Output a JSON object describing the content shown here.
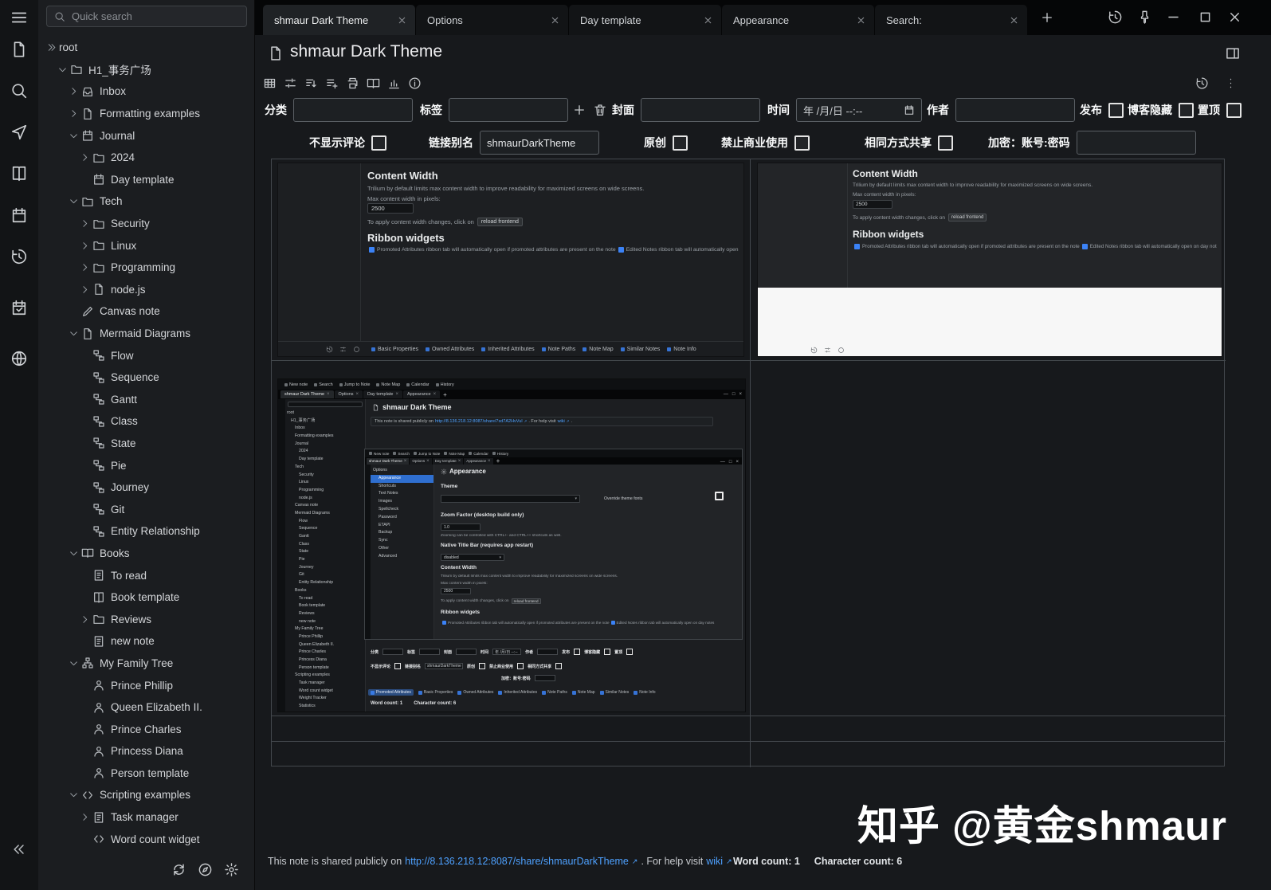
{
  "titlebar": {
    "tabs": [
      {
        "label": "shmaur Dark Theme",
        "active": true
      },
      {
        "label": "Options",
        "active": false
      },
      {
        "label": "Day template",
        "active": false
      },
      {
        "label": "Appearance",
        "active": false
      },
      {
        "label": "Search:",
        "active": false
      }
    ]
  },
  "activity_bar": {
    "icons": [
      "menu",
      "file",
      "search",
      "send",
      "book",
      "calendar",
      "history",
      "calendar-check",
      "globe"
    ],
    "collapse_icon": "chevrons-left"
  },
  "sidebar": {
    "quick_search_placeholder": "Quick search",
    "footer_icons": [
      "sync",
      "compass",
      "gear"
    ],
    "tree": [
      {
        "level": 0,
        "chevron": "double",
        "icon": null,
        "label": "root"
      },
      {
        "level": 1,
        "chevron": "down",
        "icon": "folder",
        "label": "H1_事务广场"
      },
      {
        "level": 2,
        "chevron": "right",
        "icon": "inbox",
        "label": "Inbox"
      },
      {
        "level": 2,
        "chevron": "right",
        "icon": "file",
        "label": "Formatting examples"
      },
      {
        "level": 2,
        "chevron": "down",
        "icon": "calendar",
        "label": "Journal"
      },
      {
        "level": 3,
        "chevron": "right",
        "icon": "folder",
        "label": "2024"
      },
      {
        "level": 3,
        "chevron": null,
        "icon": "calendar",
        "label": "Day template"
      },
      {
        "level": 2,
        "chevron": "down",
        "icon": "folder",
        "label": "Tech"
      },
      {
        "level": 3,
        "chevron": "right",
        "icon": "folder",
        "label": "Security"
      },
      {
        "level": 3,
        "chevron": "right",
        "icon": "folder",
        "label": "Linux"
      },
      {
        "level": 3,
        "chevron": "right",
        "icon": "folder",
        "label": "Programming"
      },
      {
        "level": 3,
        "chevron": "right",
        "icon": "file",
        "label": "node.js"
      },
      {
        "level": 2,
        "chevron": null,
        "icon": "pencil",
        "label": "Canvas note"
      },
      {
        "level": 2,
        "chevron": "down",
        "icon": "file",
        "label": "Mermaid Diagrams"
      },
      {
        "level": 3,
        "chevron": null,
        "icon": "diagram",
        "label": "Flow"
      },
      {
        "level": 3,
        "chevron": null,
        "icon": "diagram",
        "label": "Sequence"
      },
      {
        "level": 3,
        "chevron": null,
        "icon": "diagram",
        "label": "Gantt"
      },
      {
        "level": 3,
        "chevron": null,
        "icon": "diagram",
        "label": "Class"
      },
      {
        "level": 3,
        "chevron": null,
        "icon": "diagram",
        "label": "State"
      },
      {
        "level": 3,
        "chevron": null,
        "icon": "diagram",
        "label": "Pie"
      },
      {
        "level": 3,
        "chevron": null,
        "icon": "diagram",
        "label": "Journey"
      },
      {
        "level": 3,
        "chevron": null,
        "icon": "diagram",
        "label": "Git"
      },
      {
        "level": 3,
        "chevron": null,
        "icon": "diagram",
        "label": "Entity Relationship"
      },
      {
        "level": 2,
        "chevron": "down",
        "icon": "book-open",
        "label": "Books"
      },
      {
        "level": 3,
        "chevron": null,
        "icon": "note",
        "label": "To read"
      },
      {
        "level": 3,
        "chevron": null,
        "icon": "book",
        "label": "Book template"
      },
      {
        "level": 3,
        "chevron": "right",
        "icon": "folder",
        "label": "Reviews"
      },
      {
        "level": 3,
        "chevron": null,
        "icon": "note",
        "label": "new note"
      },
      {
        "level": 2,
        "chevron": "down",
        "icon": "tree",
        "label": "My Family Tree"
      },
      {
        "level": 3,
        "chevron": null,
        "icon": "person",
        "label": "Prince Phillip"
      },
      {
        "level": 3,
        "chevron": null,
        "icon": "person",
        "label": "Queen Elizabeth II."
      },
      {
        "level": 3,
        "chevron": null,
        "icon": "person",
        "label": "Prince Charles"
      },
      {
        "level": 3,
        "chevron": null,
        "icon": "person",
        "label": "Princess Diana"
      },
      {
        "level": 3,
        "chevron": null,
        "icon": "person",
        "label": "Person template"
      },
      {
        "level": 2,
        "chevron": "down",
        "icon": "code",
        "label": "Scripting examples"
      },
      {
        "level": 3,
        "chevron": "right",
        "icon": "note",
        "label": "Task manager"
      },
      {
        "level": 3,
        "chevron": null,
        "icon": "code",
        "label": "Word count widget"
      }
    ]
  },
  "ribbon": {
    "icons": [
      "table",
      "sliders",
      "sort-list",
      "list-plus",
      "printer",
      "book-open",
      "chart",
      "info"
    ],
    "right_icons": [
      "history",
      "dots-v"
    ]
  },
  "note": {
    "title": "shmaur Dark Theme",
    "attr_row1": [
      {
        "key": "category",
        "label": "分类",
        "kind": "input",
        "value": ""
      },
      {
        "key": "tags",
        "label": "标签",
        "kind": "input",
        "value": ""
      },
      {
        "key": "cover",
        "label": "封面",
        "kind": "input",
        "value": ""
      },
      {
        "key": "time",
        "label": "时间",
        "kind": "date",
        "value": "年 /月/日 --:--"
      },
      {
        "key": "author",
        "label": "作者",
        "kind": "input",
        "value": ""
      },
      {
        "key": "publish",
        "label": "发布",
        "kind": "check"
      },
      {
        "key": "blog-hidden",
        "label": "博客隐藏",
        "kind": "check"
      },
      {
        "key": "pinned",
        "label": "置顶",
        "kind": "check"
      }
    ],
    "attr_row2": [
      {
        "key": "hide-comments",
        "label": "不显示评论",
        "kind": "check"
      },
      {
        "key": "link-alias",
        "label": "链接别名",
        "kind": "input",
        "value": "shmaurDarkTheme"
      },
      {
        "key": "original",
        "label": "原创",
        "kind": "check"
      },
      {
        "key": "no-commercial",
        "label": "禁止商业使用",
        "kind": "check"
      },
      {
        "key": "share-alike",
        "label": "相同方式共享",
        "kind": "check"
      },
      {
        "key": "encrypt",
        "label": "加密：账号:密码",
        "kind": "input",
        "value": ""
      }
    ]
  },
  "settings_shot": {
    "content_width_heading": "Content Width",
    "content_width_desc": "Trilium by default limits max content width to improve readability for maximized screens on wide screens.",
    "max_width_label": "Max content width in pixels:",
    "max_width_value": "2500",
    "apply_text": "To apply content width changes, click on",
    "reload_button": "reload frontend",
    "ribbon_heading": "Ribbon widgets",
    "check1": "Promoted Attributes ribbon tab will automatically open if promoted attributes are present on the note",
    "check2": "Edited Notes ribbon tab will automatically open on day notes",
    "footer_tabs": [
      "Basic Properties",
      "Owned Attributes",
      "Inherited Attributes",
      "Note Paths",
      "Note Map",
      "Similar Notes",
      "Note Info"
    ]
  },
  "app_shot": {
    "toolbar": [
      "New note",
      "Search",
      "Jump to Note",
      "Note Map",
      "Calendar",
      "History"
    ],
    "tabs": [
      "shmaur Dark Theme",
      "Options",
      "Day template",
      "Appearance"
    ],
    "title": "shmaur Dark Theme",
    "share_prefix": "This note is shared publicly on",
    "share_link": "http://8.136.218.12:8087/share/7sd7A2HvVul",
    "share_mid": ". For help visit",
    "share_wiki": "wiki",
    "share_suffix": ".",
    "tree_extra": [
      "Weight Tracker",
      "Statistics"
    ],
    "footer_tabs": [
      "Promoted Attributes",
      "Basic Properties",
      "Owned Attributes",
      "Inherited Attributes",
      "Note Paths",
      "Note Map",
      "Similar Notes",
      "Note Info"
    ],
    "word_count": "Word count: 1",
    "char_count": "Character count: 6",
    "inner": {
      "options_tree": [
        "Options",
        "Appearance",
        "Shortcuts",
        "Text Notes",
        "Images",
        "Spellcheck",
        "Password",
        "ETAPI",
        "Backup",
        "Sync",
        "Other",
        "Advanced"
      ],
      "page_title": "Appearance",
      "theme_heading": "Theme",
      "override_fonts": "Override theme fonts",
      "zoom_heading": "Zoom Factor (desktop build only)",
      "zoom_value": "1.0",
      "zoom_desc": "Zooming can be controlled with CTRL+- and CTRL++ shortcuts as well.",
      "native_bar_heading": "Native Title Bar (requires app restart)",
      "native_bar_value": "disabled"
    }
  },
  "status": {
    "share_prefix": "This note is shared publicly on",
    "share_link": "http://8.136.218.12:8087/share/shmaurDarkTheme",
    "share_mid": ". For help visit",
    "share_wiki": "wiki",
    "share_suffix": ".",
    "word_count": "Word count: 1",
    "char_count": "Character count: 6"
  },
  "watermark": "知乎 @黄金shmaur"
}
